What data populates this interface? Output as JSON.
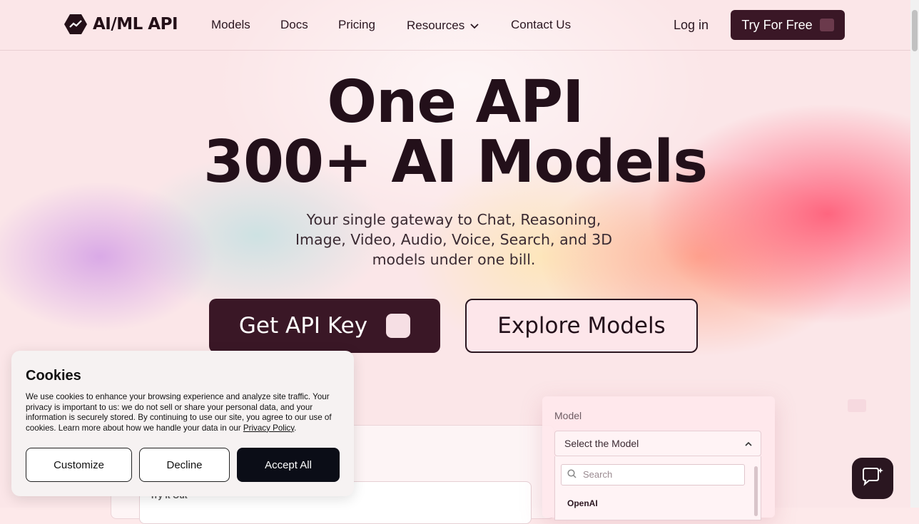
{
  "header": {
    "logo_text": "AI/ML API",
    "nav": [
      "Models",
      "Docs",
      "Pricing",
      "Resources",
      "Contact Us"
    ],
    "login": "Log in",
    "try_free": "Try For Free"
  },
  "hero": {
    "title_line1": "One API",
    "title_line2": "300+ AI Models",
    "subtitle": "Your single gateway to Chat, Reasoning, Image, Video, Audio, Voice, Search, and 3D models under one bill.",
    "cta_primary": "Get API Key",
    "cta_secondary": "Explore Models"
  },
  "playground": {
    "try_it_out": "Try it Out",
    "model_label": "Model",
    "model_select": "Select the Model",
    "search_placeholder": "Search",
    "first_group": "OpenAI"
  },
  "cookies": {
    "title": "Cookies",
    "text": "We use cookies to enhance your browsing experience and analyze site traffic. Your privacy is important to us: we do not sell or share your personal data, and your information is securely stored. By continuing to use our site, you agree to our use of cookies. Learn more about how we handle your data in our",
    "policy_link": "Privacy Policy",
    "customize": "Customize",
    "decline": "Decline",
    "accept": "Accept All"
  },
  "icons": {
    "logo": "hexagon-trend-icon",
    "chevron": "chevron-down-icon",
    "search": "search-icon",
    "chat": "chat-sparkle-icon"
  }
}
